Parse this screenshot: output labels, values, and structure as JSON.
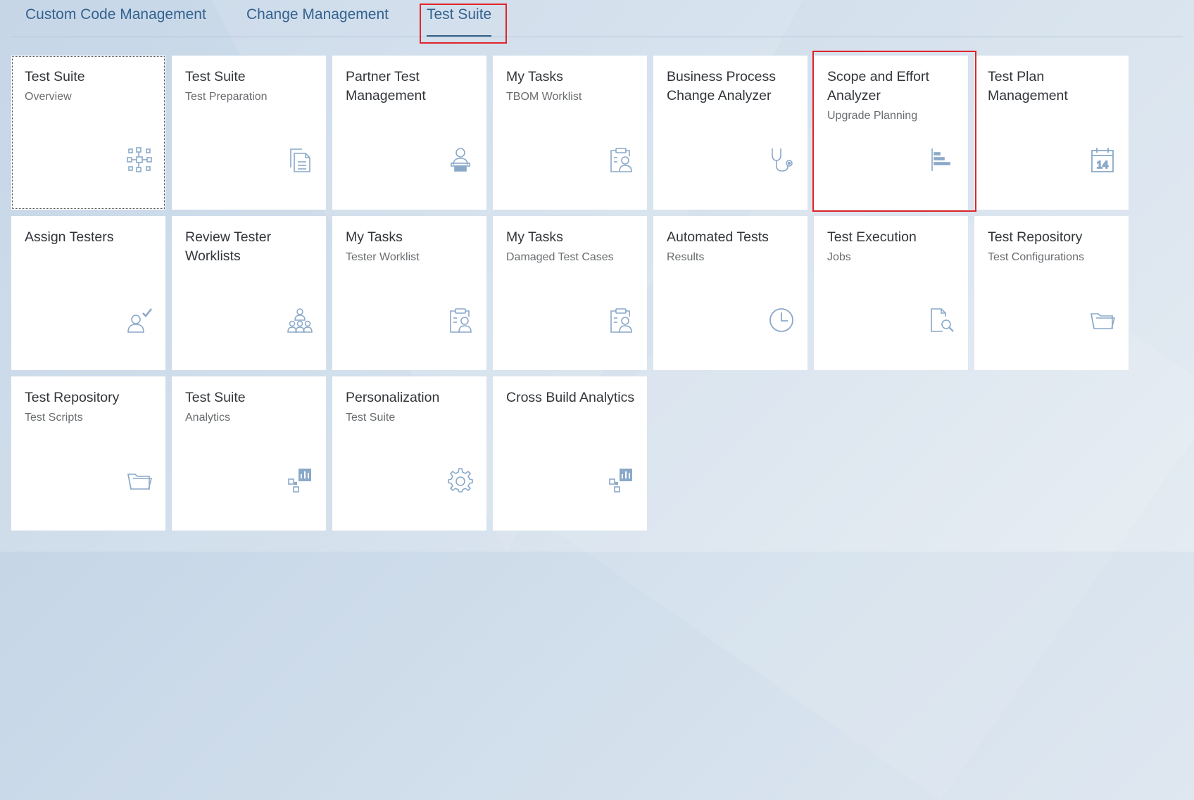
{
  "tabs": [
    {
      "label": "Custom Code Management"
    },
    {
      "label": "Change Management"
    },
    {
      "label": "Test Suite",
      "active": true
    }
  ],
  "accent": "#346187",
  "highlight_color": "#e0242a",
  "tiles": [
    {
      "title": "Test Suite",
      "subtitle": "Overview",
      "icon": "network-icon"
    },
    {
      "title": "Test Suite",
      "subtitle": "Test Preparation",
      "icon": "documents-icon"
    },
    {
      "title": "Partner Test Management",
      "subtitle": "",
      "icon": "person-desk-icon"
    },
    {
      "title": "My Tasks",
      "subtitle": "TBOM Worklist",
      "icon": "clipboard-person-icon"
    },
    {
      "title": "Business Process Change Analyzer",
      "subtitle": "",
      "icon": "stethoscope-icon"
    },
    {
      "title": "Scope and Effort Analyzer",
      "subtitle": "Upgrade Planning",
      "icon": "horizontal-bars-icon"
    },
    {
      "title": "Test Plan Management",
      "subtitle": "",
      "icon": "calendar-icon",
      "icon_text": "14"
    },
    {
      "title": "Assign Testers",
      "subtitle": "",
      "icon": "person-check-icon"
    },
    {
      "title": "Review Tester Worklists",
      "subtitle": "",
      "icon": "group-icon"
    },
    {
      "title": "My Tasks",
      "subtitle": "Tester Worklist",
      "icon": "clipboard-person-icon"
    },
    {
      "title": "My Tasks",
      "subtitle": "Damaged Test Cases",
      "icon": "clipboard-person-icon"
    },
    {
      "title": "Automated Tests",
      "subtitle": "Results",
      "icon": "clock-icon"
    },
    {
      "title": "Test Execution",
      "subtitle": "Jobs",
      "icon": "document-search-icon"
    },
    {
      "title": "Test Repository",
      "subtitle": "Test Configurations",
      "icon": "folder-open-icon"
    },
    {
      "title": "Test Repository",
      "subtitle": "Test Scripts",
      "icon": "folder-open-icon"
    },
    {
      "title": "Test Suite",
      "subtitle": "Analytics",
      "icon": "analytics-icon"
    },
    {
      "title": "Personalization",
      "subtitle": "Test Suite",
      "icon": "gear-icon"
    },
    {
      "title": "Cross Build Analytics",
      "subtitle": "",
      "icon": "analytics-icon"
    }
  ]
}
